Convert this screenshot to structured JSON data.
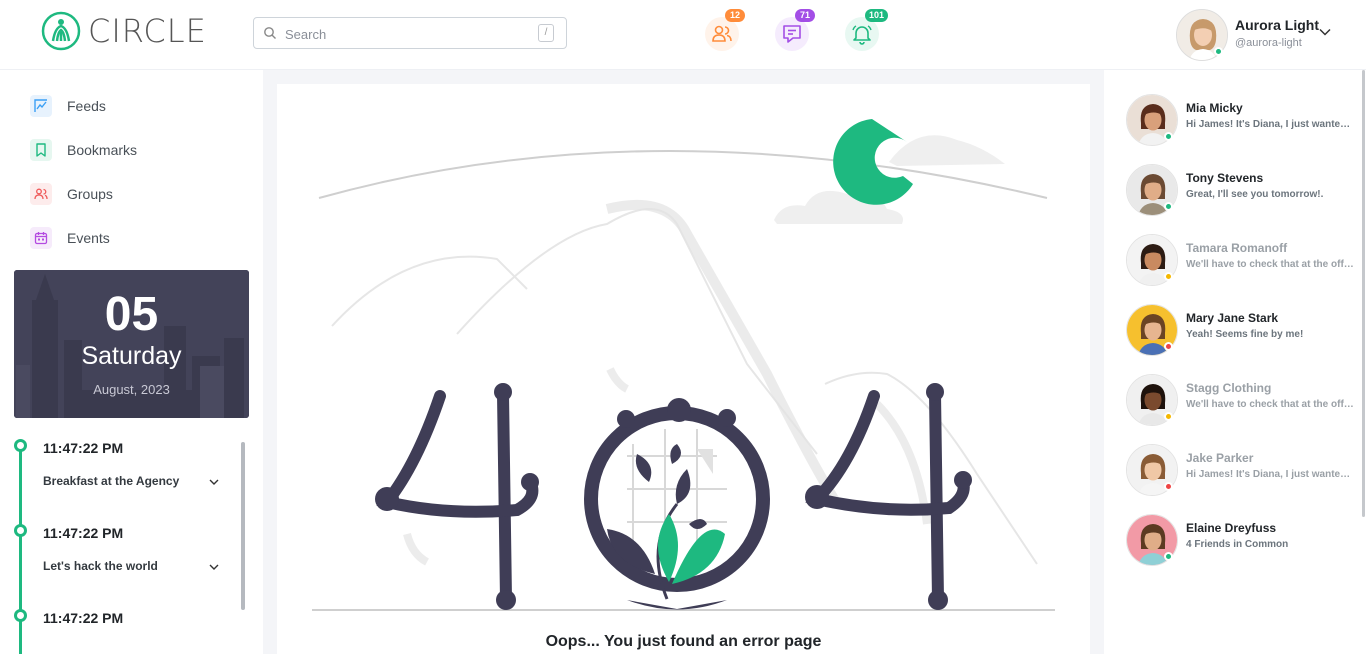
{
  "app": {
    "logo_text": "CIRCLE",
    "brand_color": "#1eb980"
  },
  "search": {
    "placeholder": "Search",
    "shortcut": "/"
  },
  "header_actions": [
    {
      "name": "friends",
      "icon": "users-icon",
      "badge": "12",
      "color": "#ff8c3a",
      "bg": "#fff3ea"
    },
    {
      "name": "messages",
      "icon": "message-icon",
      "badge": "71",
      "color": "#a34ee6",
      "bg": "#f5ecfd"
    },
    {
      "name": "notifications",
      "icon": "bell-icon",
      "badge": "101",
      "color": "#1eb980",
      "bg": "#e8f8f2"
    }
  ],
  "profile": {
    "name": "Aurora Light",
    "handle": "@aurora-light"
  },
  "nav": [
    {
      "label": "Feeds",
      "icon": "feeds-icon",
      "color": "#3a9ff5",
      "bg": "#e7f2fd"
    },
    {
      "label": "Bookmarks",
      "icon": "bookmark-icon",
      "color": "#1eb980",
      "bg": "#e6f7f0"
    },
    {
      "label": "Groups",
      "icon": "users-icon",
      "color": "#ef5a5a",
      "bg": "#fdecec"
    },
    {
      "label": "Events",
      "icon": "calendar-icon",
      "color": "#b44be1",
      "bg": "#f6ebfb"
    }
  ],
  "date_card": {
    "day": "05",
    "weekday": "Saturday",
    "month": "August, 2023"
  },
  "timeline": [
    {
      "time": "11:47:22 PM",
      "title": "Breakfast at the Agency"
    },
    {
      "time": "11:47:22 PM",
      "title": "Let's hack the world"
    },
    {
      "time": "11:47:22 PM",
      "title": ""
    }
  ],
  "error": {
    "message": "Oops... You just found an error page"
  },
  "contacts": [
    {
      "name": "Mia Micky",
      "message": "Hi James! It's Diana, I just wanted to let you know",
      "status_color": "#1eb980",
      "dim": false,
      "skin": "#d9a07b",
      "hair": "#5a2d1c",
      "shirt": "#f2f2f2",
      "bg": "#eadfd6"
    },
    {
      "name": "Tony Stevens",
      "message": "Great, I'll see you tomorrow!.",
      "status_color": "#1eb980",
      "dim": false,
      "skin": "#e0ad88",
      "hair": "#6b4a33",
      "shirt": "#9c8f7a",
      "bg": "#e9e9e9"
    },
    {
      "name": "Tamara Romanoff",
      "message": "We'll have to check that at the office",
      "status_color": "#f5b800",
      "dim": true,
      "skin": "#c98a60",
      "hair": "#2d1c14",
      "shirt": "#f0f0f0",
      "bg": "#f3f3f3"
    },
    {
      "name": "Mary Jane Stark",
      "message": "Yeah! Seems fine by me!",
      "status_color": "#ef4444",
      "dim": false,
      "skin": "#e7b590",
      "hair": "#6b4424",
      "shirt": "#4a70b5",
      "bg": "#f6c02e"
    },
    {
      "name": "Stagg Clothing",
      "message": "We'll have to check that at the office",
      "status_color": "#f5b800",
      "dim": true,
      "skin": "#7a4a2e",
      "hair": "#1e120c",
      "shirt": "#e8e8e8",
      "bg": "#f0f0f0"
    },
    {
      "name": "Jake Parker",
      "message": "Hi James! It's Diana, I just wanted to let you know",
      "status_color": "#ef4444",
      "dim": true,
      "skin": "#f0c8a6",
      "hair": "#8a5c36",
      "shirt": "#f5f5f5",
      "bg": "#f2f2f2"
    },
    {
      "name": "Elaine Dreyfuss",
      "message": "4 Friends in Common",
      "status_color": "#1eb980",
      "dim": false,
      "skin": "#e0ad88",
      "hair": "#5c3a22",
      "shirt": "#8fd0d6",
      "bg": "#f29aa6"
    }
  ]
}
